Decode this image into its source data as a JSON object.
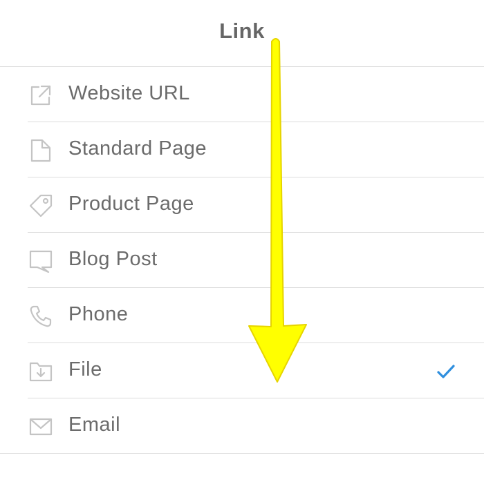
{
  "header": {
    "title": "Link"
  },
  "items": [
    {
      "label": "Website URL",
      "icon": "external-link-icon",
      "selected": false
    },
    {
      "label": "Standard Page",
      "icon": "page-icon",
      "selected": false
    },
    {
      "label": "Product Page",
      "icon": "tag-icon",
      "selected": false
    },
    {
      "label": "Blog Post",
      "icon": "chat-bubble-icon",
      "selected": false
    },
    {
      "label": "Phone",
      "icon": "phone-icon",
      "selected": false
    },
    {
      "label": "File",
      "icon": "file-download-icon",
      "selected": true
    },
    {
      "label": "Email",
      "icon": "envelope-icon",
      "selected": false
    }
  ],
  "colors": {
    "text": "#6b6b6b",
    "icon": "#c4c4c4",
    "divider": "#dcdcdc",
    "check": "#2f8fde",
    "arrow_fill": "#ffff00",
    "arrow_stroke": "#e6d400"
  }
}
